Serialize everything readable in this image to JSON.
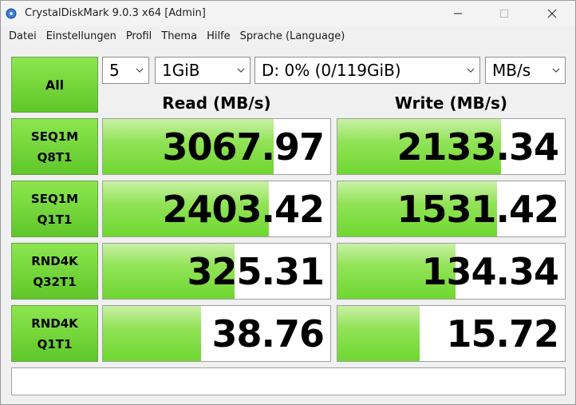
{
  "window": {
    "title": "CrystalDiskMark 9.0.3 x64 [Admin]",
    "icon": "crystaldiskmark-disk-icon"
  },
  "menu": [
    "Datei",
    "Einstellungen",
    "Profil",
    "Thema",
    "Hilfe",
    "Sprache (Language)"
  ],
  "controls": {
    "all_label": "All",
    "count": "5",
    "size": "1GiB",
    "drive": "D: 0% (0/119GiB)",
    "unit": "MB/s"
  },
  "headers": {
    "read": "Read (MB/s)",
    "write": "Write (MB/s)"
  },
  "rows": [
    {
      "line1": "SEQ1M",
      "line2": "Q8T1",
      "read": "3067.97",
      "write": "2133.34",
      "read_fill": 0.75,
      "write_fill": 0.72
    },
    {
      "line1": "SEQ1M",
      "line2": "Q1T1",
      "read": "2403.42",
      "write": "1531.42",
      "read_fill": 0.73,
      "write_fill": 0.7
    },
    {
      "line1": "RND4K",
      "line2": "Q32T1",
      "read": "325.31",
      "write": "134.34",
      "read_fill": 0.58,
      "write_fill": 0.52
    },
    {
      "line1": "RND4K",
      "line2": "Q1T1",
      "read": "38.76",
      "write": "15.72",
      "read_fill": 0.43,
      "write_fill": 0.36
    }
  ],
  "status": "",
  "colors": {
    "accent_green": "#6fd730",
    "button_green": "#8de64f"
  }
}
